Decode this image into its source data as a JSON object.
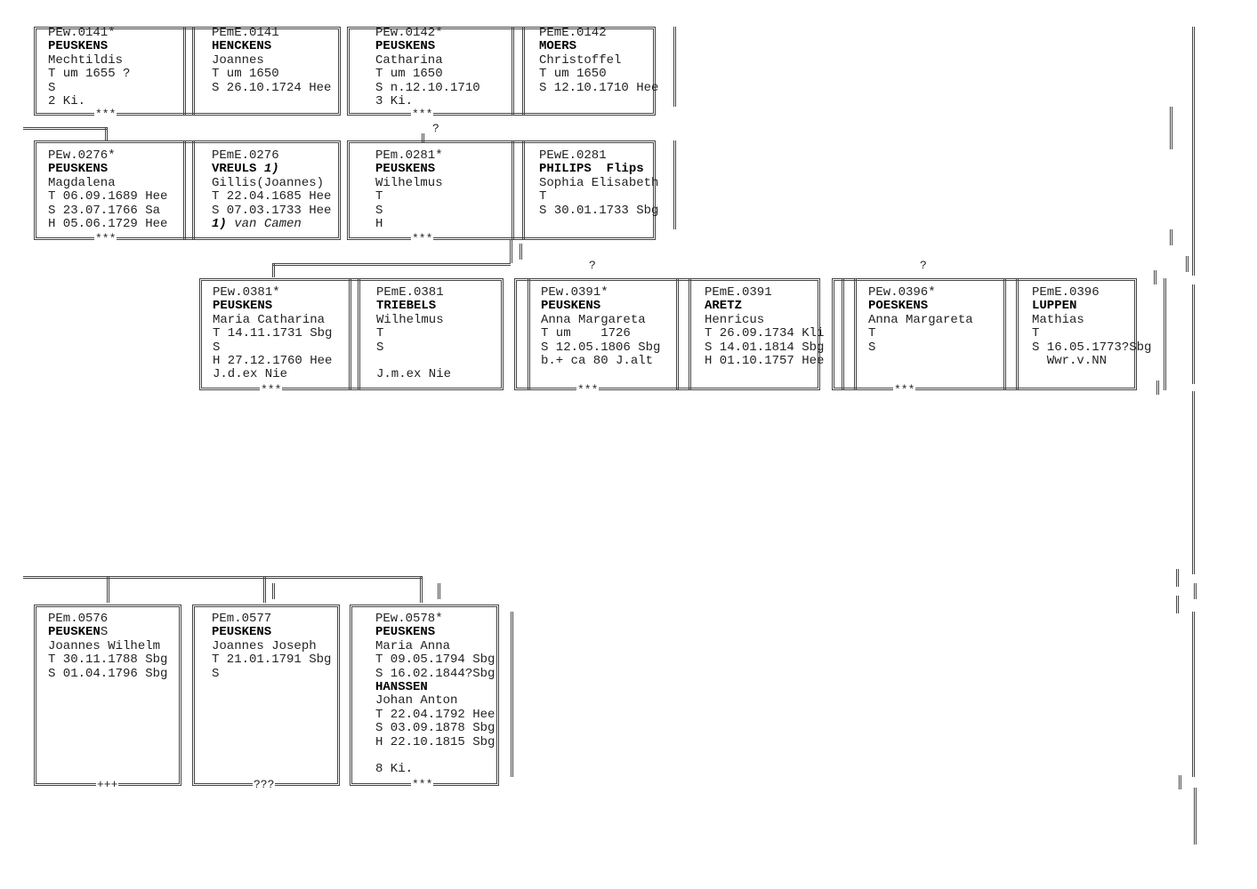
{
  "row1": [
    {
      "id": "PEw.0141*",
      "surname": "PEUSKENS",
      "given": "Mechtildis",
      "lines": [
        "T um 1655 ?",
        "S",
        "2 Ki."
      ]
    },
    {
      "id": "PEmE.0141",
      "surname": "HENCKENS",
      "given": "Joannes",
      "lines": [
        "T um 1650",
        "S 26.10.1724 Hee",
        ""
      ]
    },
    {
      "id": "PEw.0142*",
      "surname": "PEUSKENS",
      "given": "Catharina",
      "lines": [
        "T um 1650",
        "S n.12.10.1710",
        "3 Ki."
      ]
    },
    {
      "id": "PEmE.0142",
      "surname": "MOERS",
      "given": "Christoffel",
      "lines": [
        "T um 1650",
        "S 12.10.1710 Hee",
        ""
      ]
    }
  ],
  "row1_marks": [
    "***",
    "***"
  ],
  "row2": [
    {
      "id": "PEw.0276*",
      "surname": "PEUSKENS",
      "surname_suffix": "",
      "given": "Magdalena",
      "lines": [
        "T 06.09.1689 Hee",
        "S 23.07.1766 Sa",
        "H 05.06.1729 Hee"
      ]
    },
    {
      "id": "PEmE.0276",
      "surname": "VREULS",
      "surname_suffix": "1)",
      "given": "Gillis(Joannes)",
      "lines": [
        "T 22.04.1685 Hee",
        "S 07.03.1733 Hee"
      ],
      "note_num": "1)",
      "note_text": "van Camen"
    },
    {
      "id": "PEm.0281*",
      "surname": "PEUSKENS",
      "surname_suffix": "",
      "given": "Wilhelmus",
      "lines": [
        "T",
        "S",
        "H"
      ]
    },
    {
      "id": "PEwE.0281",
      "surname": "PHILIPS  Flips",
      "surname_suffix": "",
      "given": "Sophia Elisabeth",
      "lines": [
        "T",
        "S 30.01.1733 Sbg",
        ""
      ]
    }
  ],
  "row2_marks": [
    "***",
    "***"
  ],
  "row3": [
    {
      "id": "PEw.0381*",
      "surname": "PEUSKENS",
      "given": "Maria Catharina",
      "lines": [
        "T 14.11.1731 Sbg",
        "S",
        "H 27.12.1760 Hee",
        "J.d.ex Nie"
      ]
    },
    {
      "id": "PEmE.0381",
      "surname": "TRIEBELS",
      "given": "Wilhelmus",
      "lines": [
        "T",
        "S",
        "",
        "J.m.ex Nie"
      ]
    },
    {
      "id": "PEw.0391*",
      "surname": "PEUSKENS",
      "given": "Anna Margareta",
      "lines": [
        "T um    1726",
        "S 12.05.1806 Sbg",
        "b.+ ca 80 J.alt",
        ""
      ]
    },
    {
      "id": "PEmE.0391",
      "surname": "ARETZ",
      "given": "Henricus",
      "lines": [
        "T 26.09.1734 Kli",
        "S 14.01.1814 Sbg",
        "H 01.10.1757 Hee",
        ""
      ]
    },
    {
      "id": "PEw.0396*",
      "surname": "POESKENS",
      "given": "Anna Margareta",
      "lines": [
        "T",
        "S",
        "",
        ""
      ]
    },
    {
      "id": "PEmE.0396",
      "surname": "LUPPEN",
      "given": "Mathias",
      "lines": [
        "T",
        "S 16.05.1773?Sbg",
        "  Wwr.v.NN",
        ""
      ]
    }
  ],
  "row3_marks": [
    "***",
    "***",
    "***"
  ],
  "question_marks": [
    "?",
    "?",
    "?"
  ],
  "row4": [
    {
      "id": "PEm.0576",
      "surname": "PEUSKEN",
      "surname_tail": "S",
      "given": "Joannes Wilhelm",
      "lines": [
        "T 30.11.1788 Sbg",
        "S 01.04.1796 Sbg"
      ],
      "mark": "+++"
    },
    {
      "id": "PEm.0577",
      "surname": "PEUSKENS",
      "surname_tail": "",
      "given": "Joannes Joseph",
      "lines": [
        "T 21.01.1791 Sbg",
        "S"
      ],
      "mark": "???"
    },
    {
      "id": "PEw.0578*",
      "surname": "PEUSKENS",
      "surname_tail": "",
      "given": "Maria Anna",
      "lines": [
        "T 09.05.1794 Sbg",
        "S 16.02.1844?Sbg"
      ],
      "spouse_surname": "HANSSEN",
      "spouse_given": "Johan Anton",
      "spouse_lines": [
        "T 22.04.1792 Hee",
        "S 03.09.1878 Sbg",
        "H 22.10.1815 Sbg",
        "",
        "8 Ki."
      ],
      "mark": "***"
    }
  ]
}
